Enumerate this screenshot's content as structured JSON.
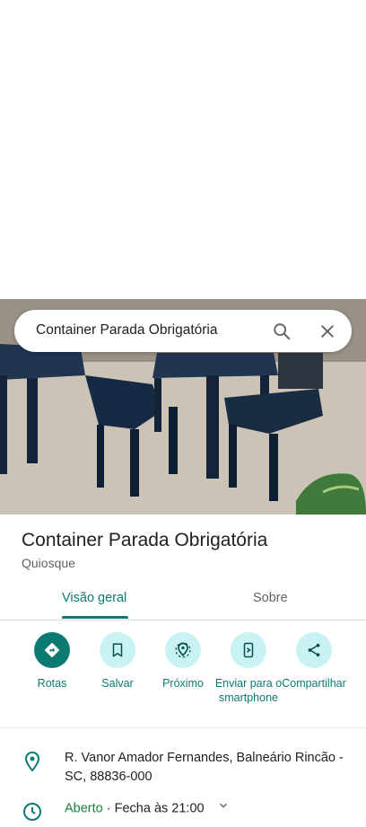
{
  "search": {
    "query": "Container Parada Obrigatória",
    "search_icon": "search-icon",
    "close_icon": "close-icon"
  },
  "place": {
    "name": "Container Parada Obrigatória",
    "category": "Quiosque"
  },
  "tabs": [
    {
      "label": "Visão geral",
      "active": true
    },
    {
      "label": "Sobre",
      "active": false
    }
  ],
  "actions": [
    {
      "label": "Rotas",
      "icon": "directions-icon"
    },
    {
      "label": "Salvar",
      "icon": "bookmark-icon"
    },
    {
      "label": "Próximo",
      "icon": "nearby-icon"
    },
    {
      "label": "Enviar para o smartphone",
      "icon": "send-to-phone-icon"
    },
    {
      "label": "Compartilhar",
      "icon": "share-icon"
    }
  ],
  "info": {
    "address": "R. Vanor Amador Fernandes, Balneário Rincão - SC, 88836-000",
    "status": "Aberto",
    "hours": " · Fecha às 21:00"
  },
  "colors": {
    "accent": "#0b7b72",
    "action_bg": "#c9f2f4",
    "open_green": "#188038"
  }
}
